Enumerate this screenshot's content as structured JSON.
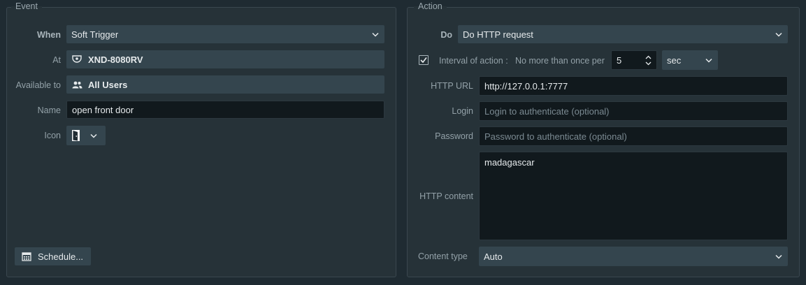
{
  "event": {
    "title": "Event",
    "when_label": "When",
    "when_value": "Soft Trigger",
    "at_label": "At",
    "at_value": "XND-8080RV",
    "available_label": "Available to",
    "available_value": "All Users",
    "name_label": "Name",
    "name_value": "open front door",
    "icon_label": "Icon",
    "schedule_button": "Schedule..."
  },
  "action": {
    "title": "Action",
    "do_label": "Do",
    "do_value": "Do HTTP request",
    "interval_checked": true,
    "interval_label": "Interval of action :",
    "interval_text": "No more than once per",
    "interval_value": "5",
    "interval_unit": "sec",
    "url_label": "HTTP URL",
    "url_value": "http://127.0.0.1:7777",
    "login_label": "Login",
    "login_placeholder": "Login to authenticate (optional)",
    "password_label": "Password",
    "password_placeholder": "Password to authenticate (optional)",
    "content_label": "HTTP content",
    "content_value": "madagascar",
    "content_type_label": "Content type",
    "content_type_value": "Auto"
  }
}
